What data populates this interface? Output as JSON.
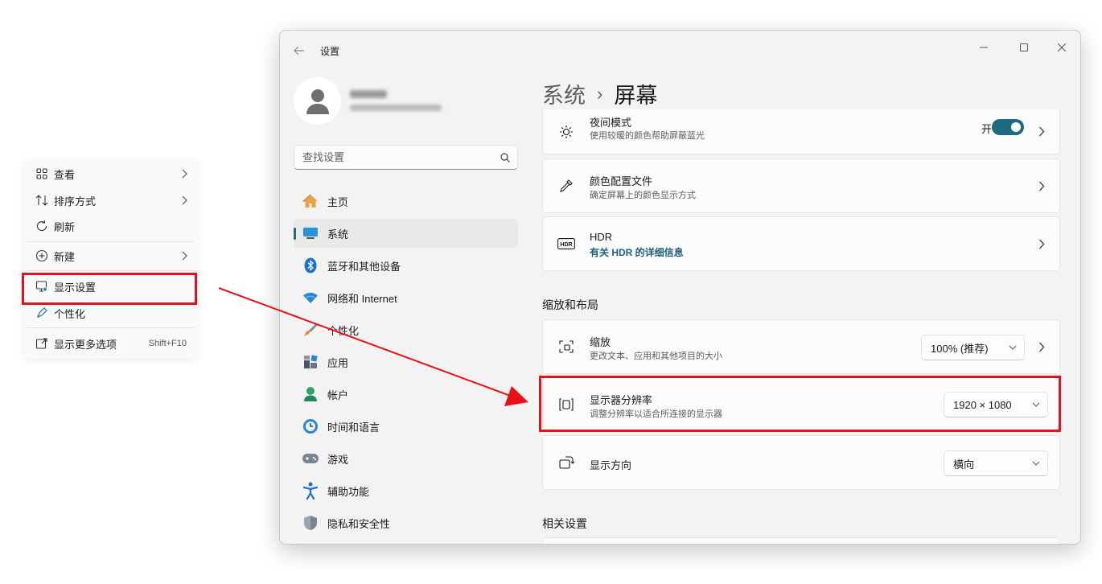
{
  "context_menu": {
    "items": [
      {
        "label": "查看",
        "icon": "grid-view-icon",
        "submenu": true
      },
      {
        "label": "排序方式",
        "icon": "sort-icon",
        "submenu": true
      },
      {
        "label": "刷新",
        "icon": "refresh-icon",
        "submenu": false
      },
      {
        "label": "新建",
        "icon": "add-circle-icon",
        "submenu": true
      },
      {
        "label": "显示设置",
        "icon": "display-settings-icon",
        "submenu": false
      },
      {
        "label": "个性化",
        "icon": "pen-brush-icon",
        "submenu": false
      },
      {
        "label": "显示更多选项",
        "icon": "more-options-icon",
        "shortcut": "Shift+F10"
      }
    ]
  },
  "window": {
    "title": "设置",
    "search": {
      "placeholder": "查找设置"
    },
    "nav": [
      {
        "label": "主页",
        "icon": "home-icon"
      },
      {
        "label": "系统",
        "icon": "system-display-icon",
        "active": true
      },
      {
        "label": "蓝牙和其他设备",
        "icon": "bluetooth-icon"
      },
      {
        "label": "网络和 Internet",
        "icon": "wifi-icon"
      },
      {
        "label": "个性化",
        "icon": "personalization-brush-icon"
      },
      {
        "label": "应用",
        "icon": "apps-icon"
      },
      {
        "label": "帐户",
        "icon": "account-icon"
      },
      {
        "label": "时间和语言",
        "icon": "time-language-icon"
      },
      {
        "label": "游戏",
        "icon": "gaming-controller-icon"
      },
      {
        "label": "辅助功能",
        "icon": "accessibility-icon"
      },
      {
        "label": "隐私和安全性",
        "icon": "shield-icon"
      }
    ],
    "breadcrumb": {
      "parent": "系统",
      "separator": "›",
      "current": "屏幕"
    },
    "cards": {
      "night_light": {
        "title": "夜间模式",
        "subtitle": "使用较暖的颜色帮助屏蔽蓝光",
        "toggle_label": "开",
        "toggle_on": true
      },
      "color_profile": {
        "title": "颜色配置文件",
        "subtitle": "确定屏幕上的颜色显示方式"
      },
      "hdr": {
        "title": "HDR",
        "link": "有关 HDR 的详细信息",
        "icon_text": "HDR"
      },
      "scale": {
        "title": "缩放",
        "subtitle": "更改文本、应用和其他项目的大小",
        "value": "100% (推荐)"
      },
      "resolution": {
        "title": "显示器分辨率",
        "subtitle": "调整分辨率以适合所连接的显示器",
        "value": "1920 × 1080"
      },
      "orientation": {
        "title": "显示方向",
        "value": "横向"
      }
    },
    "sections": {
      "scale_layout": "缩放和布局",
      "related": "相关设置"
    }
  },
  "colors": {
    "accent": "#1f6a80",
    "highlight": "#e8101a",
    "arrow": "#e8101a"
  }
}
